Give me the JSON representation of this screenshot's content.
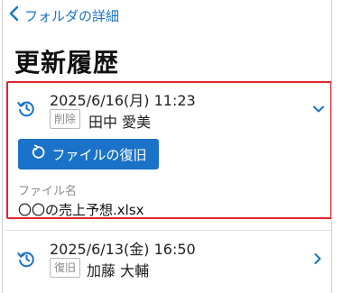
{
  "header": {
    "back_label": "フォルダの詳細"
  },
  "page": {
    "title": "更新履歴"
  },
  "history": [
    {
      "datetime": "2025/6/16(月) 11:23",
      "action": "削除",
      "user": "田中 愛美",
      "restore_label": "ファイルの復旧",
      "file_label": "ファイル名",
      "file_name": "〇〇の売上予想.xlsx"
    },
    {
      "datetime": "2025/6/13(金) 16:50",
      "action": "復旧",
      "user": "加藤 大輔"
    }
  ],
  "colors": {
    "accent": "#1a73c8",
    "highlight_border": "#e0252b"
  }
}
